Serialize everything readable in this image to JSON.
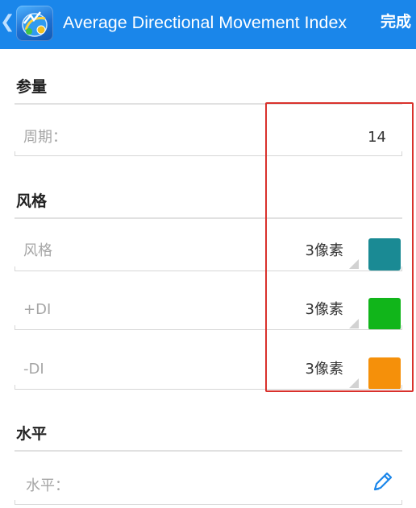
{
  "header": {
    "back_glyph": "❮",
    "title": "Average Directional Movement Index",
    "done_label": "完成",
    "background": "#1a86ea"
  },
  "sections": {
    "params": {
      "title": "参量",
      "period_label": "周期：",
      "period_value": "14"
    },
    "style": {
      "title": "风格",
      "rows": [
        {
          "label": "风格",
          "width_value": "3像素",
          "color": "#1a8a94"
        },
        {
          "label": "+DI",
          "width_value": "3像素",
          "color": "#11b51a"
        },
        {
          "label": "-DI",
          "width_value": "3像素",
          "color": "#f5900a"
        }
      ]
    },
    "levels": {
      "title": "水平",
      "level_label": "水平："
    }
  },
  "icons": {
    "app": "metatrader-app-icon",
    "edit": "pencil-icon"
  },
  "colors": {
    "highlight": "#d9312c",
    "accent": "#1a86ea"
  }
}
